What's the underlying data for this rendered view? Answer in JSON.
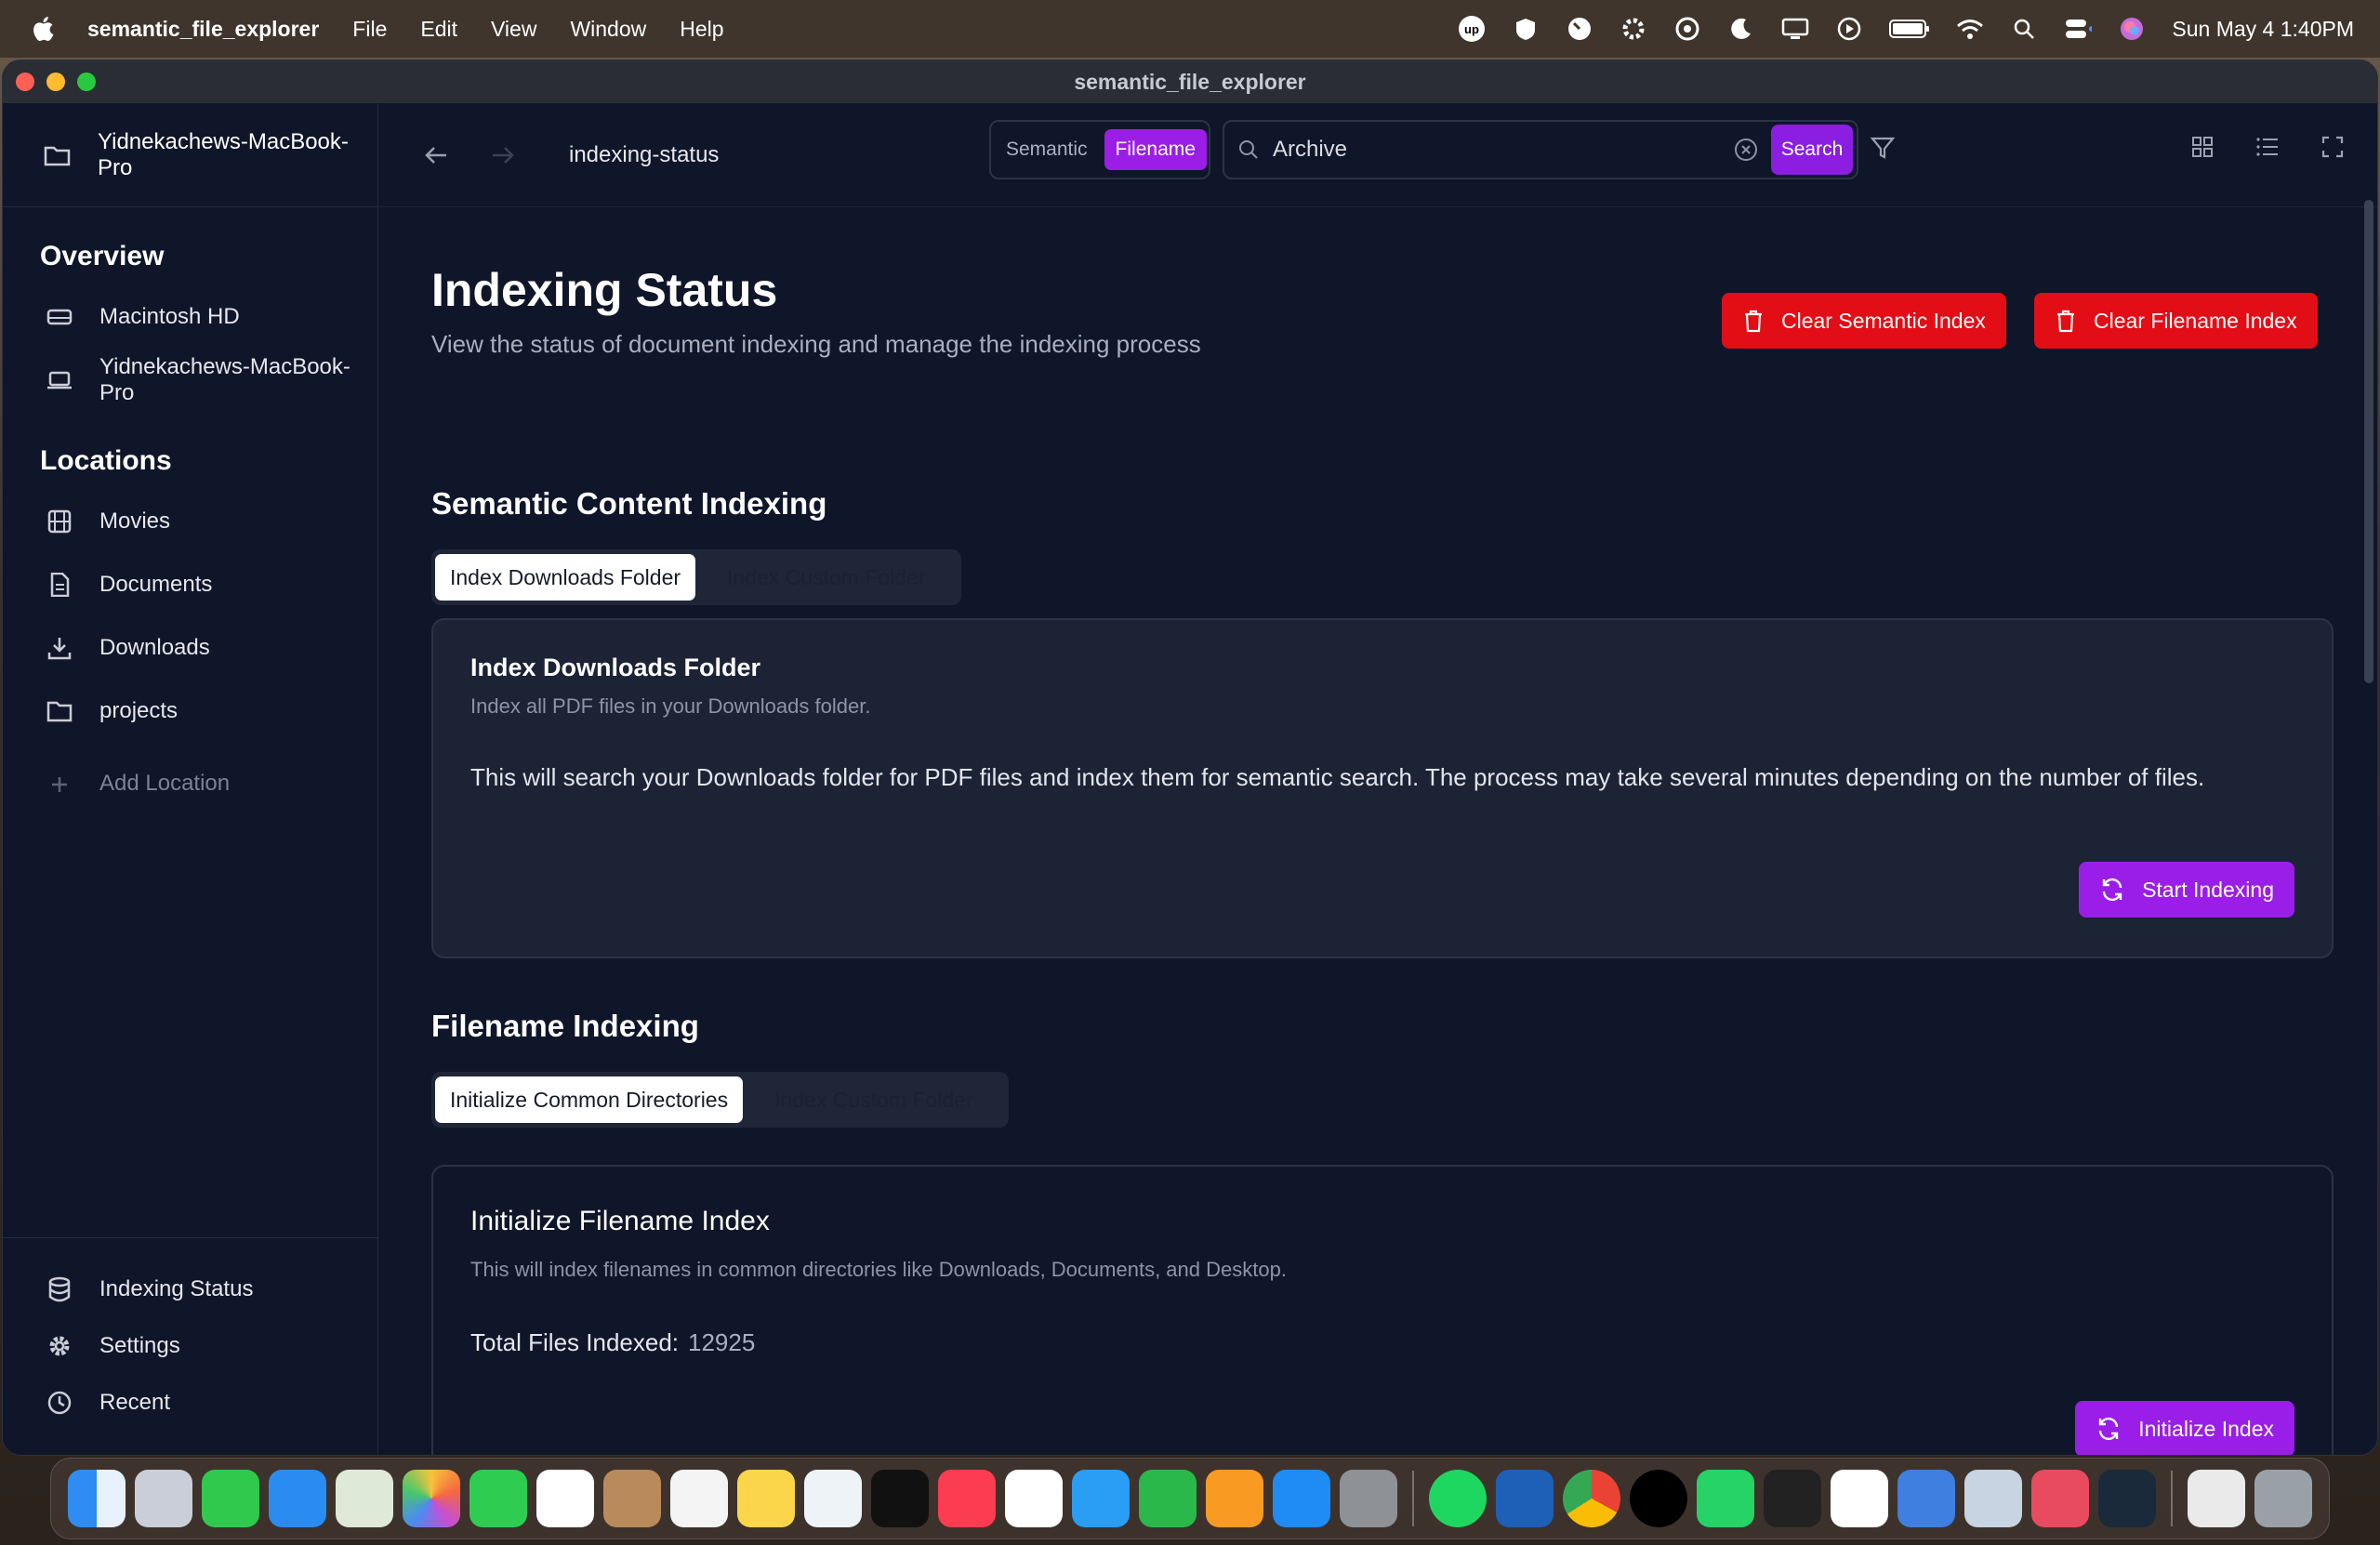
{
  "menubar": {
    "app": "semantic_file_explorer",
    "menus": [
      "File",
      "Edit",
      "View",
      "Window",
      "Help"
    ],
    "datetime": "Sun May 4  1:40PM"
  },
  "window": {
    "title": "semantic_file_explorer"
  },
  "sidebar": {
    "device": "Yidnekachews-MacBook-Pro",
    "overview_title": "Overview",
    "overview": [
      {
        "label": "Macintosh HD",
        "icon": "drive-icon"
      },
      {
        "label": "Yidnekachews-MacBook-Pro",
        "icon": "laptop-icon"
      }
    ],
    "locations_title": "Locations",
    "locations": [
      {
        "label": "Movies",
        "icon": "film-icon"
      },
      {
        "label": "Documents",
        "icon": "document-icon"
      },
      {
        "label": "Downloads",
        "icon": "download-icon"
      },
      {
        "label": "projects",
        "icon": "folder-icon"
      }
    ],
    "add_location": "Add Location",
    "bottom": [
      {
        "label": "Indexing Status",
        "icon": "database-icon"
      },
      {
        "label": "Settings",
        "icon": "gear-icon"
      },
      {
        "label": "Recent",
        "icon": "clock-icon"
      }
    ]
  },
  "toolbar": {
    "breadcrumb": "indexing-status",
    "mode_semantic": "Semantic",
    "mode_filename": "Filename",
    "active_mode": "Filename",
    "search_value": "Archive",
    "search_button": "Search"
  },
  "page": {
    "title": "Indexing Status",
    "subtitle": "View the status of document indexing and manage the indexing process",
    "clear_semantic": "Clear Semantic Index",
    "clear_filename": "Clear Filename Index"
  },
  "semantic": {
    "heading": "Semantic Content Indexing",
    "tab_active": "Index Downloads Folder",
    "tab_inactive": "Index Custom Folder",
    "card_title": "Index Downloads Folder",
    "card_desc": "Index all PDF files in your Downloads folder.",
    "card_body": "This will search your Downloads folder for PDF files and index them for semantic search. The process may take several minutes depending on the number of files.",
    "button": "Start Indexing"
  },
  "filename": {
    "heading": "Filename Indexing",
    "tab_active": "Initialize Common Directories",
    "tab_inactive": "Index Custom Folder",
    "card_title": "Initialize Filename Index",
    "card_desc": "This will index filenames in common directories like Downloads, Documents, and Desktop.",
    "stat_label": "Total Files Indexed:",
    "stat_value": "12925",
    "button": "Initialize Index"
  },
  "colors": {
    "accent": "#9a1ee8",
    "danger": "#e30d15",
    "background": "#0f1629"
  }
}
